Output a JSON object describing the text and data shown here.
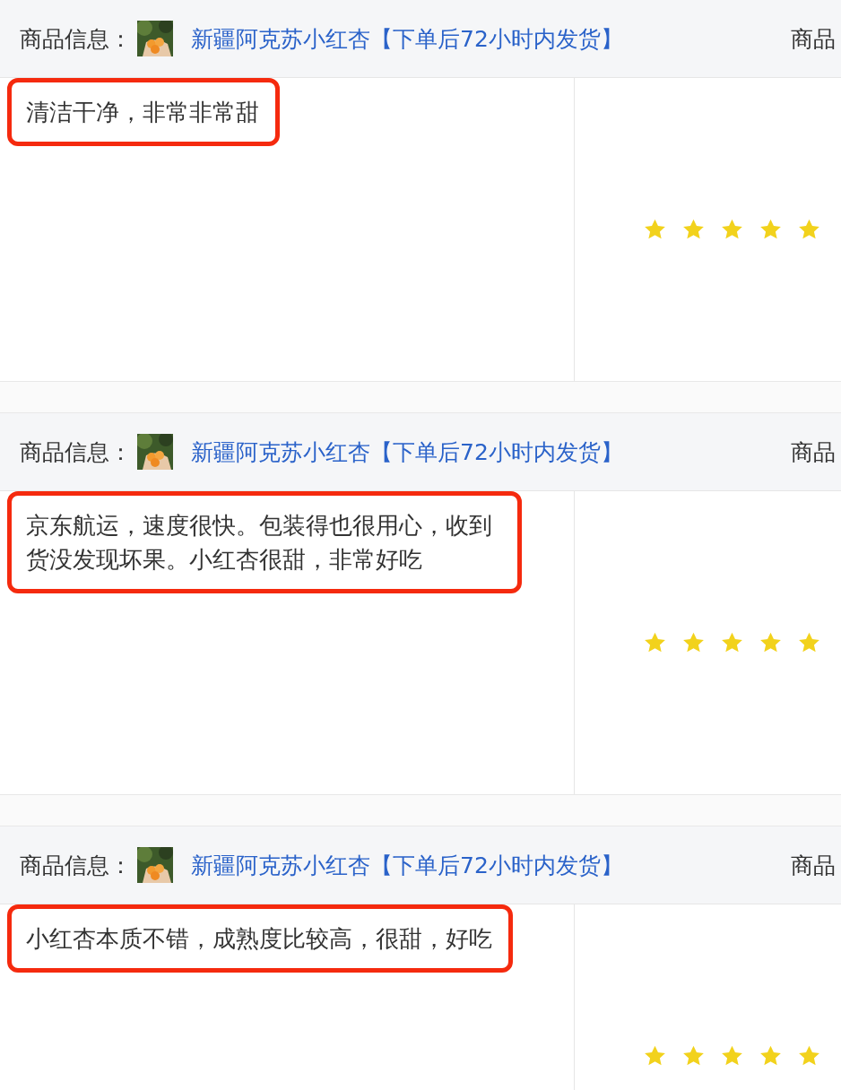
{
  "reviews": [
    {
      "product_label": "商品信息：",
      "product_name": "新疆阿克苏小红杏【下单后72小时内发货】",
      "column_3": "商品",
      "comment": "清洁干净，非常非常甜",
      "stars": 5
    },
    {
      "product_label": "商品信息：",
      "product_name": "新疆阿克苏小红杏【下单后72小时内发货】",
      "column_3": "商品",
      "comment": "京东航运，速度很快。包装得也很用心，收到货没发现坏果。小红杏很甜，非常好吃",
      "stars": 5
    },
    {
      "product_label": "商品信息：",
      "product_name": "新疆阿克苏小红杏【下单后72小时内发货】",
      "column_3": "商品",
      "comment": "小红杏本质不错，成熟度比较高，很甜，好吃",
      "stars": 5
    }
  ]
}
